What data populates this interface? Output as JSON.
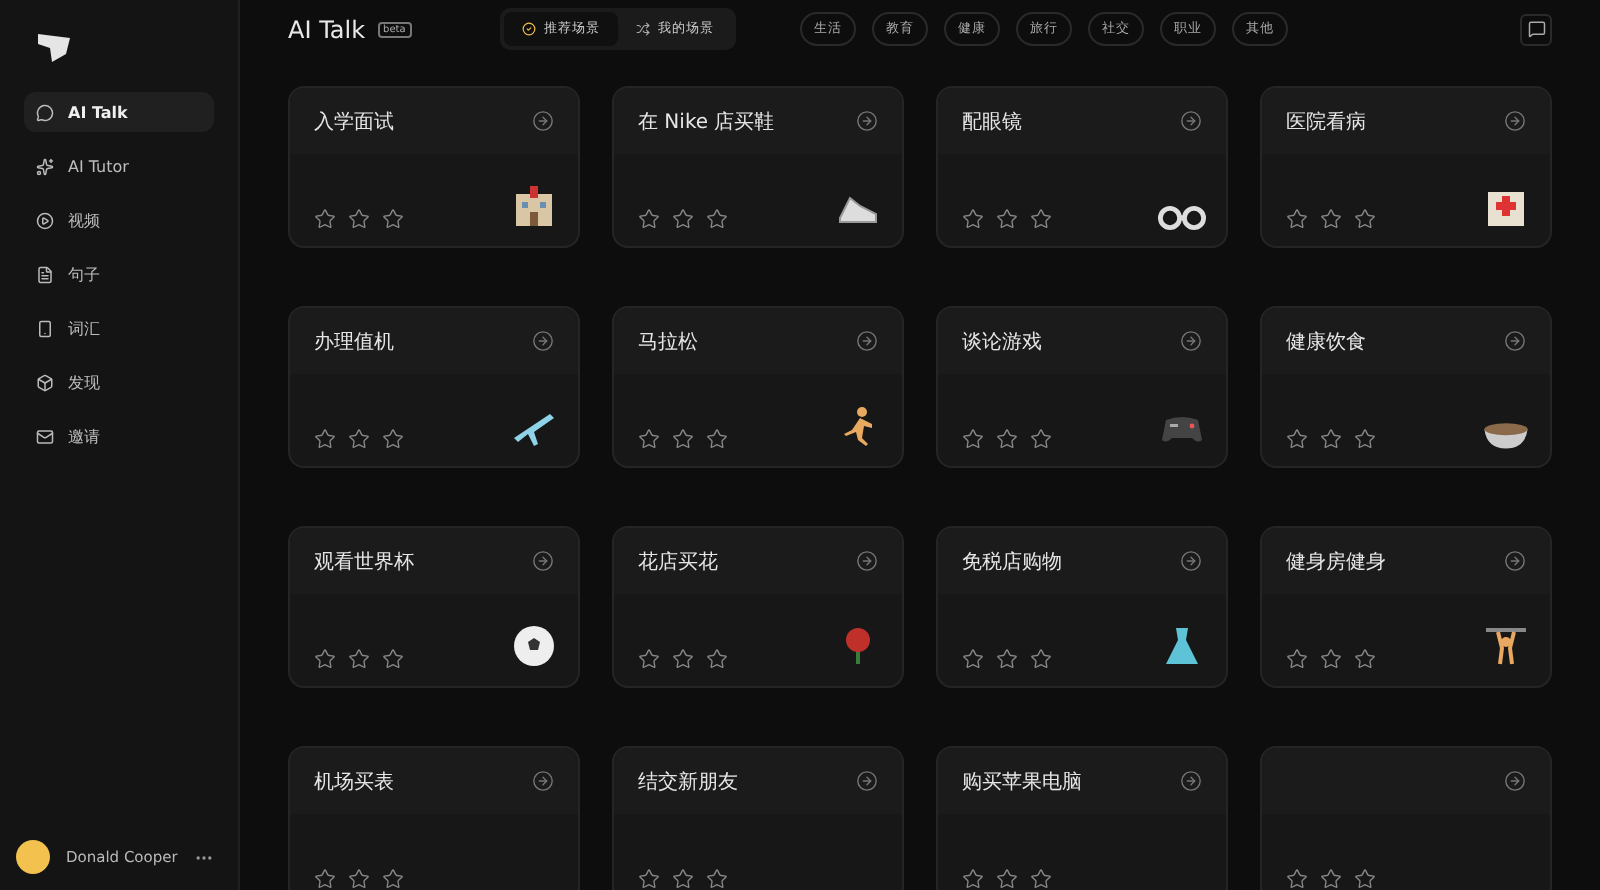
{
  "sidebar": {
    "items": [
      {
        "label": "AI Talk",
        "selected": true
      },
      {
        "label": "AI Tutor",
        "selected": false
      },
      {
        "label": "视频",
        "selected": false
      },
      {
        "label": "句子",
        "selected": false
      },
      {
        "label": "词汇",
        "selected": false
      },
      {
        "label": "发现",
        "selected": false
      },
      {
        "label": "邀请",
        "selected": false
      }
    ],
    "user": {
      "name": "Donald Cooper"
    }
  },
  "header": {
    "title": "AI Talk",
    "badge": "beta",
    "tabs": [
      {
        "label": "推荐场景",
        "selected": true
      },
      {
        "label": "我的场景",
        "selected": false
      }
    ],
    "categories": [
      {
        "label": "生活",
        "selected": false
      },
      {
        "label": "教育",
        "selected": false
      },
      {
        "label": "健康",
        "selected": false
      },
      {
        "label": "旅行",
        "selected": false
      },
      {
        "label": "社交",
        "selected": false
      },
      {
        "label": "职业",
        "selected": false
      },
      {
        "label": "其他",
        "selected": false
      }
    ]
  },
  "cards": [
    {
      "title": "入学面试",
      "stars": 0
    },
    {
      "title": "在 Nike 店买鞋",
      "stars": 0
    },
    {
      "title": "配眼镜",
      "stars": 0
    },
    {
      "title": "医院看病",
      "stars": 0
    },
    {
      "title": "办理值机",
      "stars": 0
    },
    {
      "title": "马拉松",
      "stars": 0
    },
    {
      "title": "谈论游戏",
      "stars": 0
    },
    {
      "title": "健康饮食",
      "stars": 0
    },
    {
      "title": "观看世界杯",
      "stars": 0
    },
    {
      "title": "花店买花",
      "stars": 0
    },
    {
      "title": "免税店购物",
      "stars": 0
    },
    {
      "title": "健身房健身",
      "stars": 0
    },
    {
      "title": "机场买表",
      "stars": 0
    },
    {
      "title": "结交新朋友",
      "stars": 0
    },
    {
      "title": "购买苹果电脑",
      "stars": 0
    },
    {
      "stars": 0
    }
  ]
}
